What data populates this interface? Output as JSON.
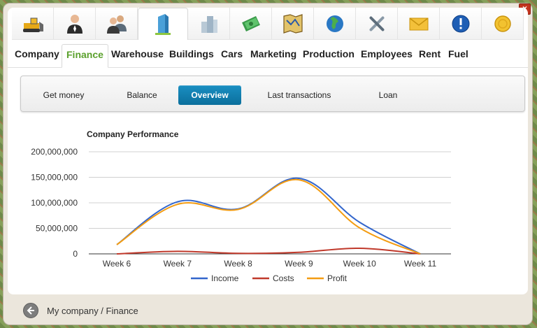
{
  "icon_tabs": [
    {
      "name": "bulldozer-icon"
    },
    {
      "name": "businessman-icon"
    },
    {
      "name": "employees-group-icon"
    },
    {
      "name": "office-building-icon",
      "active": true
    },
    {
      "name": "city-buildings-icon"
    },
    {
      "name": "money-stack-icon"
    },
    {
      "name": "map-icon"
    },
    {
      "name": "globe-icon"
    },
    {
      "name": "tools-icon"
    },
    {
      "name": "mail-icon"
    },
    {
      "name": "info-alert-icon"
    },
    {
      "name": "gold-coin-icon"
    }
  ],
  "nav": {
    "items": [
      "Company",
      "Finance",
      "Warehouse",
      "Buildings",
      "Cars",
      "Marketing",
      "Production",
      "Employees",
      "Rent",
      "Fuel"
    ],
    "active": "Finance"
  },
  "subnav": {
    "items": [
      "Get money",
      "Balance",
      "Overview",
      "Last transactions",
      "Loan"
    ],
    "active": "Overview"
  },
  "chart_data": {
    "type": "line",
    "title": "Company Performance",
    "categories": [
      "Week 6",
      "Week 7",
      "Week 8",
      "Week 9",
      "Week 10",
      "Week 11"
    ],
    "ylim": [
      0,
      200000000
    ],
    "yticks": [
      "200,000,000",
      "150,000,000",
      "100,000,000",
      "50,000,000",
      "0"
    ],
    "series": [
      {
        "name": "Income",
        "color": "#3366cc",
        "values": [
          18000000,
          102000000,
          88000000,
          148000000,
          62000000,
          0
        ]
      },
      {
        "name": "Costs",
        "color": "#c0392b",
        "values": [
          0,
          5000000,
          1000000,
          3000000,
          11000000,
          0
        ]
      },
      {
        "name": "Profit",
        "color": "#f39c12",
        "values": [
          18000000,
          97000000,
          87000000,
          145000000,
          51000000,
          0
        ]
      }
    ],
    "legend": "bottom",
    "grid": true
  },
  "footer": {
    "breadcrumb": "My company / Finance"
  },
  "window": {
    "close_label": "×"
  }
}
